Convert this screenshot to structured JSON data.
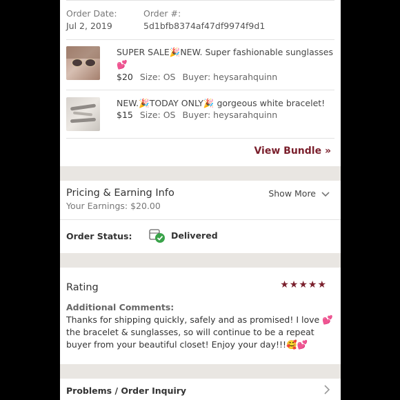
{
  "order": {
    "date_label": "Order Date:",
    "date_value": "Jul 2, 2019",
    "number_label": "Order #:",
    "number_value": "5d1bfb8374af47df9974f9d1"
  },
  "items": [
    {
      "title": "SUPER SALE🎉NEW. Super fashionable sunglasses💕",
      "price": "$20",
      "size": "Size: OS",
      "buyer": "Buyer: heysarahquinn"
    },
    {
      "title": "NEW.🎉TODAY ONLY🎉 gorgeous white bracelet!",
      "price": "$15",
      "size": "Size: OS",
      "buyer": "Buyer: heysarahquinn"
    }
  ],
  "view_bundle": "View Bundle »",
  "pricing": {
    "title": "Pricing & Earning Info",
    "earnings": "Your Earnings: $20.00",
    "show_more": "Show More"
  },
  "status": {
    "label": "Order Status:",
    "value": "Delivered"
  },
  "rating": {
    "title": "Rating",
    "stars": "★★★★★",
    "stars_value": 5,
    "comments_label": "Additional Comments:",
    "comment": "Thanks for shipping quickly, safely and as promised! I love 💕 the bracelet & sunglasses, so will continue to be a repeat buyer from your beautiful closet! Enjoy your day!!!🥰💕"
  },
  "problems": "Problems / Order Inquiry",
  "colors": {
    "accent": "#7a1f2c",
    "delivered_check": "#3aa34a",
    "band": "#e9e6e2"
  }
}
